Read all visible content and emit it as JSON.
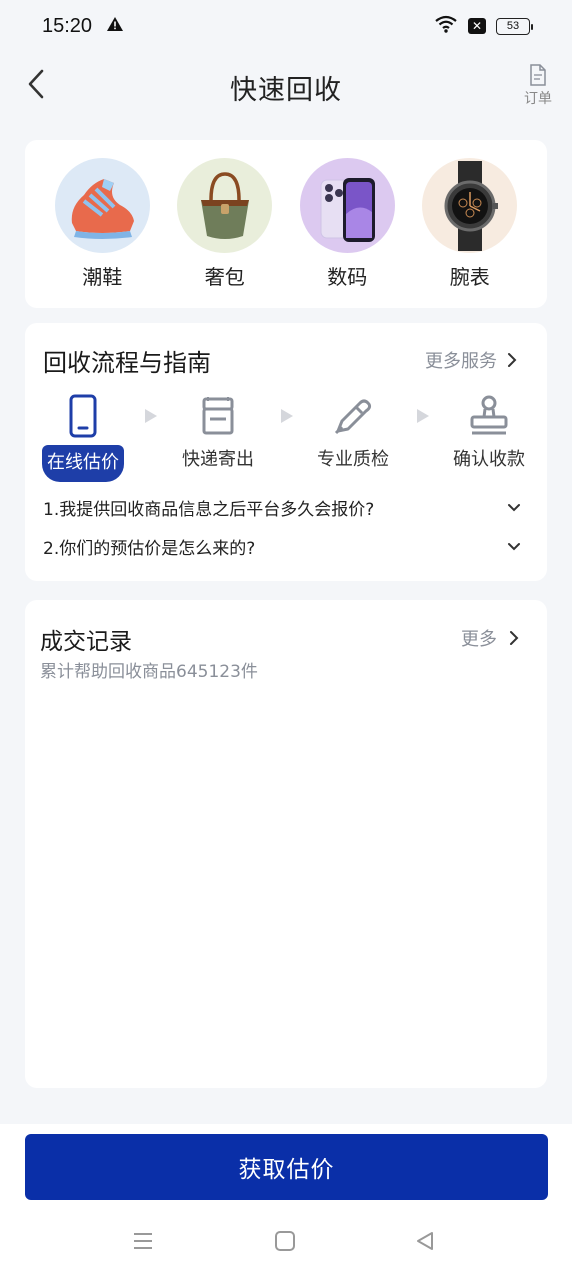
{
  "status": {
    "time": "15:20",
    "battery": "53"
  },
  "nav": {
    "title": "快速回收",
    "order_label": "订单"
  },
  "categories": [
    {
      "label": "潮鞋",
      "icon": "sneaker-image",
      "bg": "#dde9f6"
    },
    {
      "label": "奢包",
      "icon": "handbag-image",
      "bg": "#e9eedb"
    },
    {
      "label": "数码",
      "icon": "phone-image",
      "bg": "#dcc9f0"
    },
    {
      "label": "腕表",
      "icon": "watch-image",
      "bg": "#f7ebe0"
    }
  ],
  "guide": {
    "title": "回收流程与指南",
    "more": "更多服务",
    "steps": [
      {
        "label": "在线估价",
        "icon": "phone-icon",
        "active": true
      },
      {
        "label": "快递寄出",
        "icon": "package-icon"
      },
      {
        "label": "专业质检",
        "icon": "inspection-pen-icon"
      },
      {
        "label": "确认收款",
        "icon": "stamp-icon"
      }
    ],
    "faqs": [
      "1.我提供回收商品信息之后平台多久会报价?",
      "2.你们的预估价是怎么来的?"
    ]
  },
  "records": {
    "title": "成交记录",
    "more": "更多",
    "subtitle": "累计帮助回收商品645123件"
  },
  "cta": {
    "label": "获取估价"
  },
  "colors": {
    "primary": "#0a2fa8",
    "active_step": "#1e3ea8",
    "muted": "#8a8f99"
  }
}
